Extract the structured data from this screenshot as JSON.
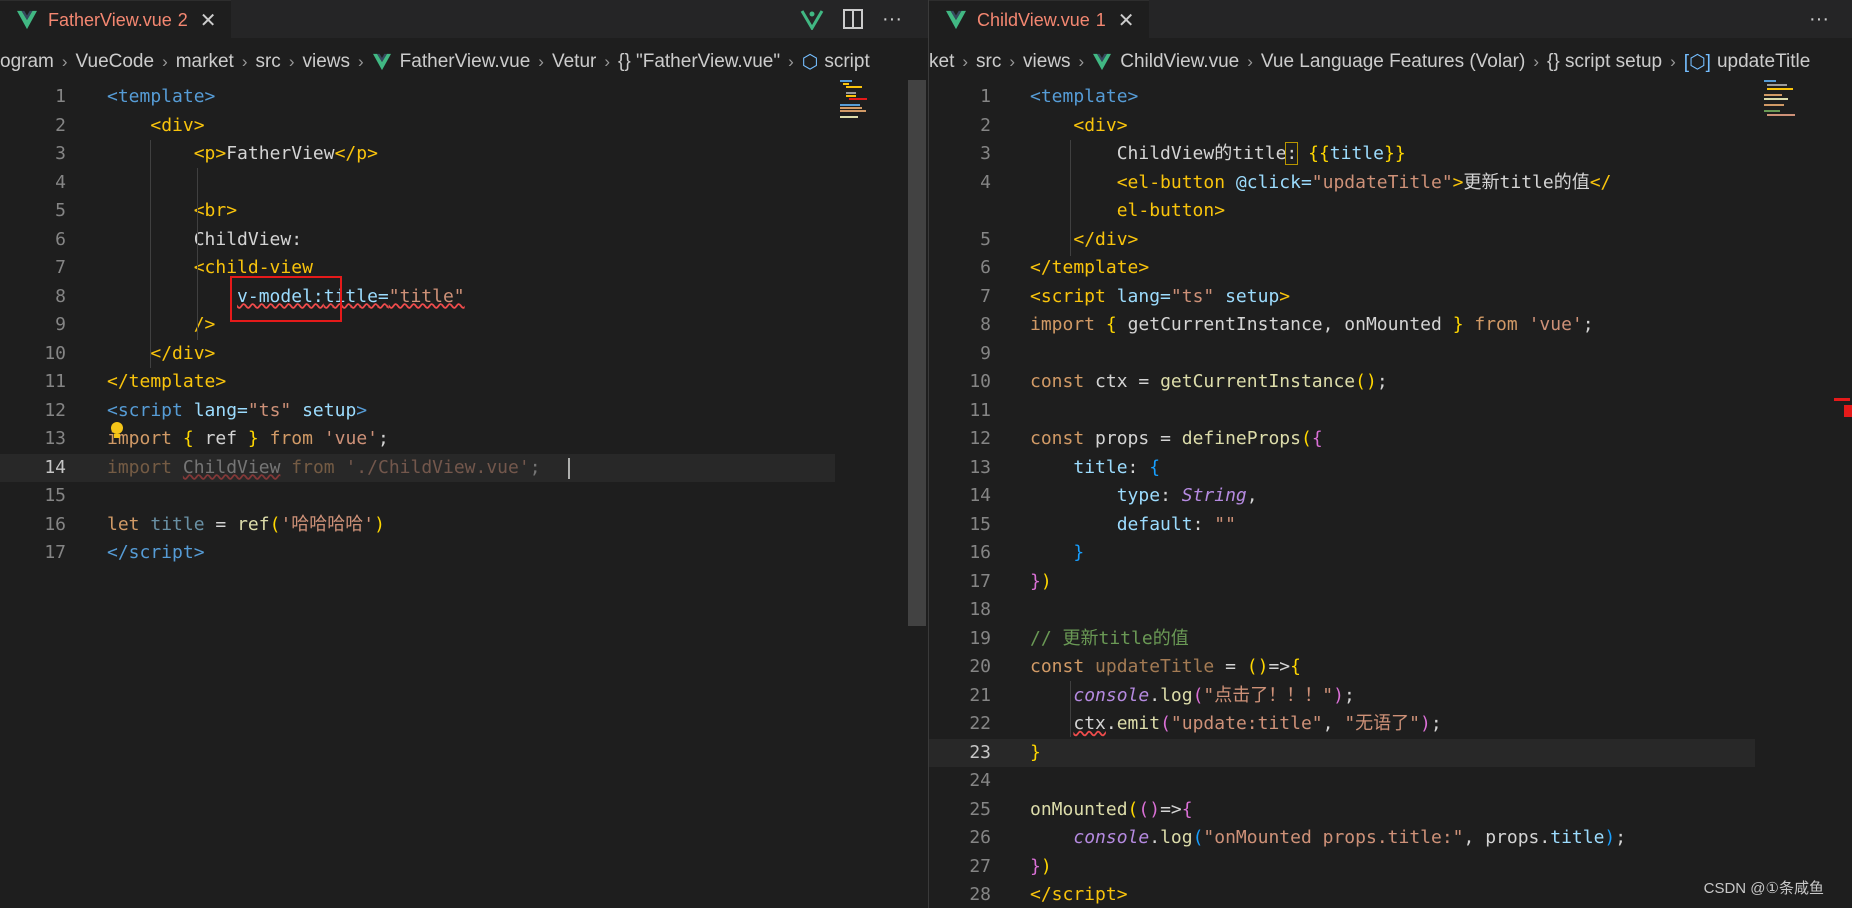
{
  "colors": {
    "editor_bg": "#1e1e1e",
    "tab_error": "#f48771",
    "vue_green": "#41b883",
    "redbox": "#e51a1a"
  },
  "left": {
    "tab": {
      "filename": "FatherView.vue",
      "problems": "2",
      "close": "✕"
    },
    "actions": {
      "more": "···"
    },
    "breadcrumb": [
      "ogram",
      "VueCode",
      "market",
      "src",
      "views",
      "FatherView.vue",
      "Vetur",
      "{} \"FatherView.vue\"",
      "script"
    ],
    "lines": [
      "1",
      "2",
      "3",
      "4",
      "5",
      "6",
      "7",
      "8",
      "9",
      "10",
      "11",
      "12",
      "13",
      "14",
      "15",
      "16",
      "17"
    ]
  },
  "right": {
    "tab": {
      "filename": "ChildView.vue",
      "problems": "1",
      "close": "✕"
    },
    "actions": {
      "more": "···"
    },
    "breadcrumb": [
      "ket",
      "src",
      "views",
      "ChildView.vue",
      "Vue Language Features (Volar)",
      "{} script setup",
      "updateTitle"
    ],
    "lines": [
      "1",
      "2",
      "3",
      "4",
      "",
      "5",
      "6",
      "7",
      "8",
      "9",
      "10",
      "11",
      "12",
      "13",
      "14",
      "15",
      "16",
      "17",
      "18",
      "19",
      "20",
      "21",
      "22",
      "23",
      "24",
      "25",
      "26",
      "27",
      "28"
    ]
  },
  "watermark": "CSDN @①条咸鱼",
  "icons": [
    "vue-file-icon",
    "close-icon",
    "git-branch-icon",
    "split-editor-icon",
    "more-actions-icon",
    "symbol-cube-icon",
    "lightbulb-icon"
  ]
}
